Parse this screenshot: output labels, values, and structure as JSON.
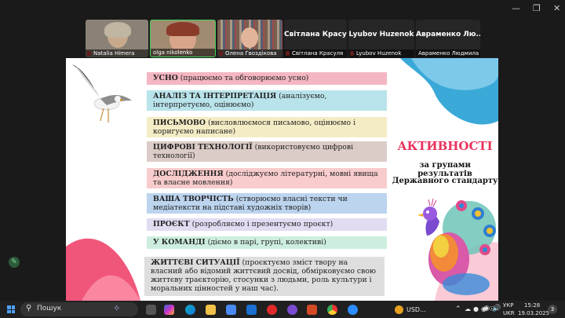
{
  "participants": [
    {
      "name": "Natalia Himera",
      "muted": true
    },
    {
      "name": "olga nikolenko",
      "muted": false
    },
    {
      "name": "Олена Гвоздікова",
      "muted": true
    },
    {
      "display": "Світлана Красуля",
      "name": "Світлана Красуля",
      "muted": true
    },
    {
      "display": "Lyubov Huzenok",
      "name": "Lyubov Huzenok",
      "muted": true
    },
    {
      "display": "Авраменко Лю...",
      "name": "Авраменко Людмила",
      "muted": false
    }
  ],
  "slide": {
    "items": [
      {
        "head": "УСНО",
        "body": " (працюємо та обговорюємо усно)",
        "color": "#f4b6c2"
      },
      {
        "head": "АНАЛІЗ ТА ІНТЕРПРЕТАЦІЯ",
        "body": " (аналізуємо, інтерпретуємо, оцінюємо)",
        "color": "#b9e3ea"
      },
      {
        "head": "ПИСЬМОВО",
        "body": " (висловлюємося письмово, оцінюємо і коригуємо написане)",
        "color": "#f4ecc4"
      },
      {
        "head": "ЦИФРОВІ ТЕХНОЛОГІЇ",
        "body": " (використовуємо цифрові технології)",
        "color": "#dcccc8"
      },
      {
        "head": "ДОСЛІДЖЕННЯ",
        "body": " (досліджуємо літературні, мовні явища та власне мовлення)",
        "color": "#f8cccc"
      },
      {
        "head": "ВАША ТВОРЧІСТЬ",
        "body": " (створюємо власні тексти чи медіатексти на підставі художніх творів)",
        "color": "#bcd4ee"
      },
      {
        "head": "ПРОЄКТ",
        "body": " (розробляємо і презентуємо проєкт)",
        "color": "#e2dcf2"
      },
      {
        "head": "У КОМАНДІ",
        "body": " (діємо в парі, групі, колективі)",
        "color": "#cdeede"
      },
      {
        "head": "ЖИТТЄВІ СИТУАЦІЇ",
        "body": " (проєктуємо зміст твору на власний або відомий життєвий досвід, обмірковуємо свою життєву траєкторію, стосунки з людьми, роль культури і моральних цінностей у наш час).",
        "color": "#dedede"
      }
    ],
    "title": "АКТИВНОСТІ",
    "subtitle1": "за групами результатів",
    "subtitle2": "Державного стандарту"
  },
  "taskbar": {
    "search_placeholder": "Пошук",
    "currency": "USD...",
    "lang1": "УКР",
    "lang2": "UKR",
    "time": "15:28",
    "date": "19.03.2025",
    "notif": "3"
  }
}
